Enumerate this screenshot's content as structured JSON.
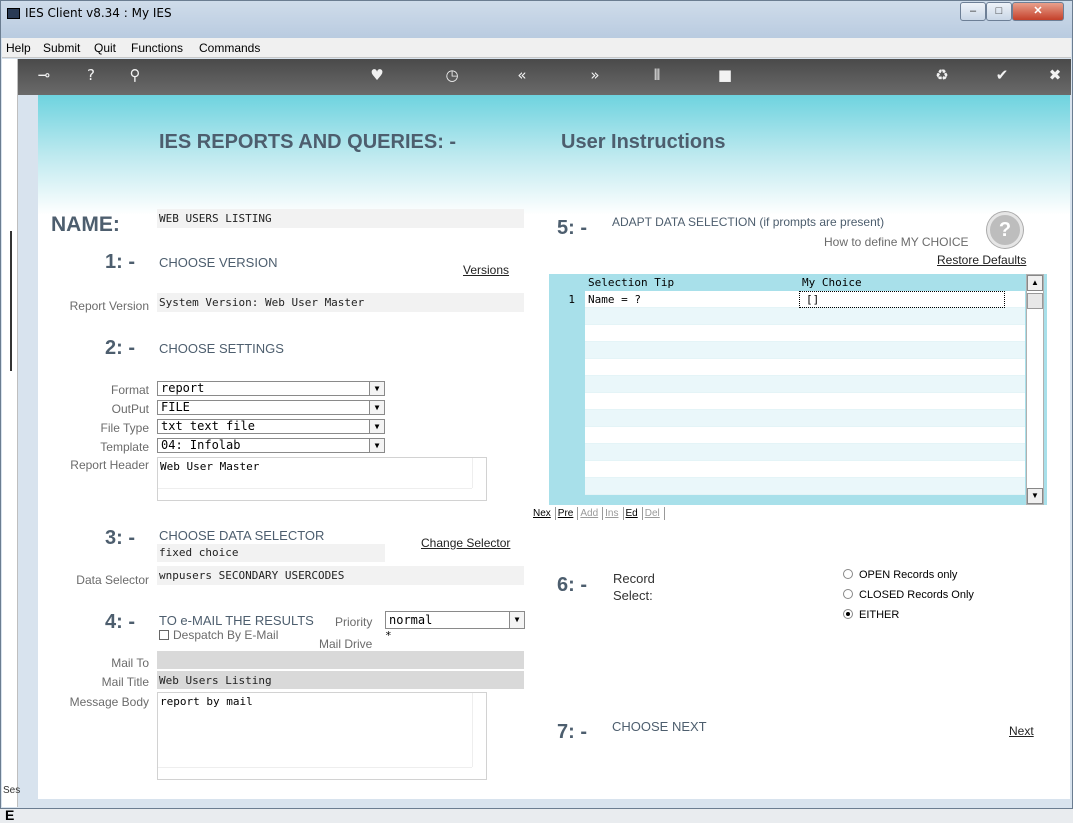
{
  "window": {
    "title": "IES Client v8.34 : My IES",
    "minimize": "–",
    "maximize": "□",
    "close": "✕"
  },
  "menu": [
    "Help",
    "Submit",
    "Quit",
    "Functions",
    "Commands"
  ],
  "toolbar_icons": [
    "key-icon",
    "help-icon",
    "search-icon",
    "heart-icon",
    "clock-icon",
    "rewind-icon",
    "forward-icon",
    "tools-icon",
    "stop-icon",
    "recycle-icon",
    "check-icon",
    "close-icon"
  ],
  "toolbar_glyphs": {
    "key": "⊸",
    "help": "?",
    "search": "⚲",
    "heart": "♥",
    "clock": "◷",
    "rewind": "«",
    "forward": "»",
    "tools": "⫴",
    "stop": "■",
    "recycle": "♻",
    "check": "✔",
    "close": "✖"
  },
  "side": {
    "ses": "Ses",
    "e": "E"
  },
  "page": {
    "heading_left": "IES REPORTS AND QUERIES: -",
    "heading_right": "User Instructions"
  },
  "name": {
    "label": "NAME:",
    "value": "WEB USERS LISTING"
  },
  "s1": {
    "num": "1: -",
    "title": "CHOOSE VERSION",
    "link": "Versions",
    "version_label": "Report Version",
    "version_value": "System Version: Web User Master"
  },
  "s2": {
    "num": "2: -",
    "title": "CHOOSE SETTINGS",
    "format_label": "Format",
    "format_value": "report",
    "output_label": "OutPut",
    "output_value": "FILE",
    "filetype_label": "File Type",
    "filetype_value": "txt text file",
    "template_label": "Template",
    "template_value": "04: Infolab",
    "header_label": "Report Header",
    "header_value": "Web User Master"
  },
  "s3": {
    "num": "3: -",
    "title": "CHOOSE DATA SELECTOR",
    "link": "Change Selector",
    "choice": "fixed choice",
    "ds_label": "Data Selector",
    "ds_value": "wnpusers SECONDARY USERCODES"
  },
  "s4": {
    "num": "4: -",
    "title": "TO e-MAIL THE RESULTS",
    "priority_label": "Priority",
    "priority_value": "normal",
    "despatch_label": "Despatch By E-Mail",
    "maildrive_label": "Mail Drive",
    "maildrive_value": "*",
    "mailto_label": "Mail To",
    "mailto_value": "",
    "mailtitle_label": "Mail Title",
    "mailtitle_value": "Web Users Listing",
    "body_label": "Message Body",
    "body_value": "report by mail"
  },
  "s5": {
    "num": "5: -",
    "title": "ADAPT DATA SELECTION (if prompts are present)",
    "howto": "How to define MY CHOICE",
    "help_glyph": "?",
    "restore": "Restore Defaults",
    "col1": "Selection Tip",
    "col2": "My Choice",
    "rows": [
      {
        "num": "1",
        "tip": "Name = ?",
        "choice": "[]"
      }
    ],
    "buttons": [
      "Nex",
      "Pre",
      "Add",
      "Ins",
      "Ed",
      "Del"
    ]
  },
  "s6": {
    "num": "6: -",
    "title": "Record",
    "title2": "Select:",
    "opt_open": "OPEN Records only",
    "opt_closed": "CLOSED Records Only",
    "opt_either": "EITHER",
    "selected": "EITHER"
  },
  "s7": {
    "num": "7: -",
    "title": "CHOOSE NEXT",
    "next": "Next"
  }
}
